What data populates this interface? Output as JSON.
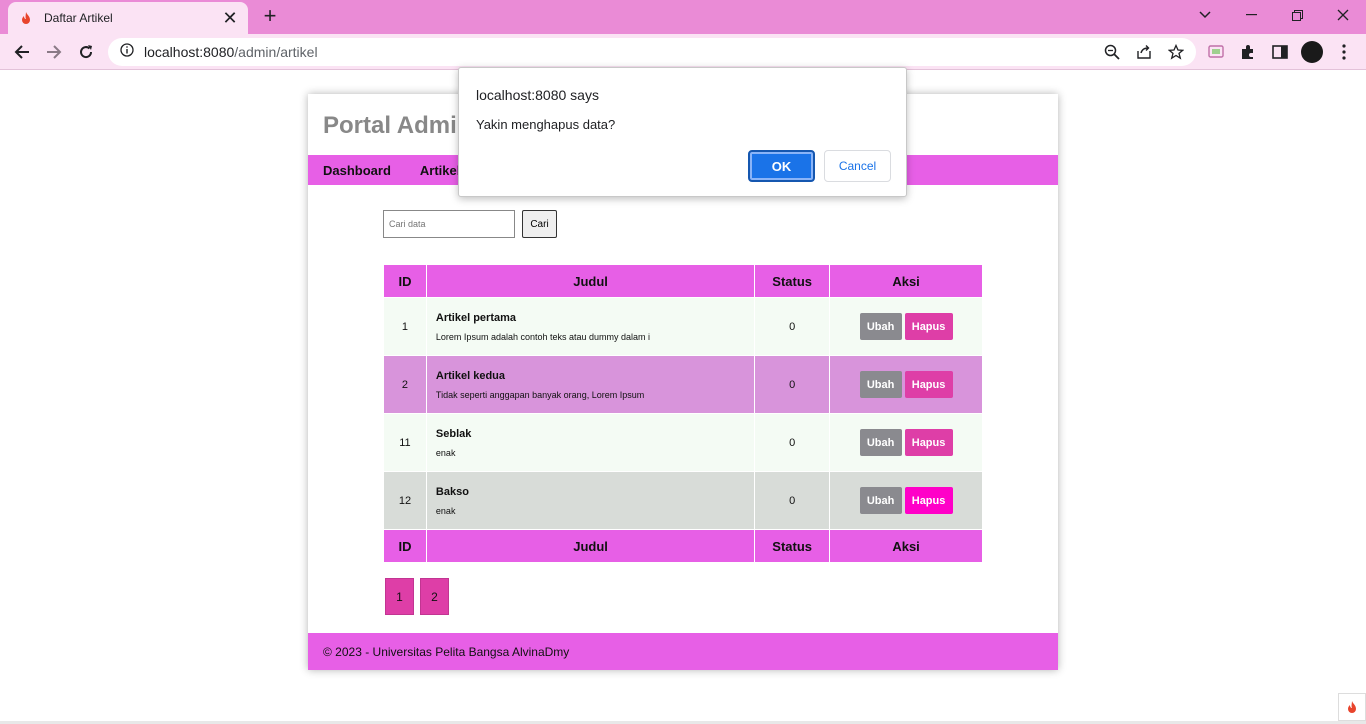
{
  "browser": {
    "tab_title": "Daftar Artikel",
    "tab_close": "✕",
    "new_tab": "+",
    "url_host": "localhost:8080",
    "url_path": "/admin/artikel"
  },
  "site": {
    "title": "Portal Admi",
    "nav": [
      "Dashboard",
      "Artikel"
    ],
    "search_placeholder": "Cari data",
    "search_button": "Cari",
    "table": {
      "headers": [
        "ID",
        "Judul",
        "Status",
        "Aksi"
      ],
      "rows": [
        {
          "id": "1",
          "title": "Artikel pertama",
          "desc": "Lorem Ipsum adalah contoh teks atau dummy dalam i",
          "status": "0"
        },
        {
          "id": "2",
          "title": "Artikel kedua",
          "desc": "Tidak seperti anggapan banyak orang, Lorem Ipsum",
          "status": "0"
        },
        {
          "id": "11",
          "title": "Seblak",
          "desc": "enak",
          "status": "0"
        },
        {
          "id": "12",
          "title": "Bakso",
          "desc": "enak",
          "status": "0"
        }
      ],
      "edit_label": "Ubah",
      "delete_label": "Hapus"
    },
    "pages": [
      "1",
      "2"
    ],
    "footer": "© 2023 - Universitas Pelita Bangsa AlvinaDmy"
  },
  "dialog": {
    "origin": "localhost:8080 says",
    "message": "Yakin menghapus data?",
    "ok": "OK",
    "cancel": "Cancel"
  },
  "colors": {
    "accent": "#e75fe6",
    "tabbar": "#ea8bd6",
    "primary_button": "#1a73e8"
  }
}
